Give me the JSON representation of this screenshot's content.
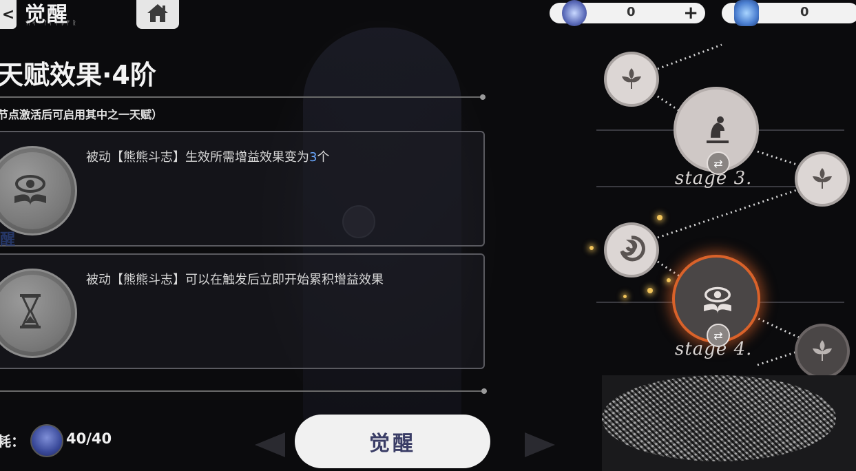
{
  "header": {
    "back_symbol": "<",
    "title": "觉醒",
    "subtitle": "ᛗᛋᚲᚠᚨᛁᛒᚠᚱ",
    "home_icon": "home-icon"
  },
  "resources": [
    {
      "icon": "currency-token-icon",
      "value": "0",
      "plus": "+"
    },
    {
      "icon": "crystal-icon",
      "value": "0"
    }
  ],
  "section": {
    "title": "天赋效果·4阶",
    "subtitle": "节点激活后可启用其中之一天赋）"
  },
  "talents": [
    {
      "icon": "eye-book-icon",
      "text_before": "被动【熊熊斗志】生效所需增益效果变为",
      "highlight": "3",
      "text_after": "个"
    },
    {
      "icon": "hourglass-icon",
      "text_before": "被动【熊熊斗志】可以在触发后立即开始累积增益效果",
      "highlight": "",
      "text_after": ""
    }
  ],
  "ghost_label": "醒",
  "cost": {
    "label": "耗：",
    "value": "40/40"
  },
  "awaken_button": "觉醒",
  "tree": {
    "stages": [
      {
        "label": "stage 3."
      },
      {
        "label": "stage 4."
      }
    ],
    "colors": {
      "selected_ring": "#d9622a",
      "node_fill": "#dcd6d4",
      "spark": "#f2c45a"
    }
  }
}
